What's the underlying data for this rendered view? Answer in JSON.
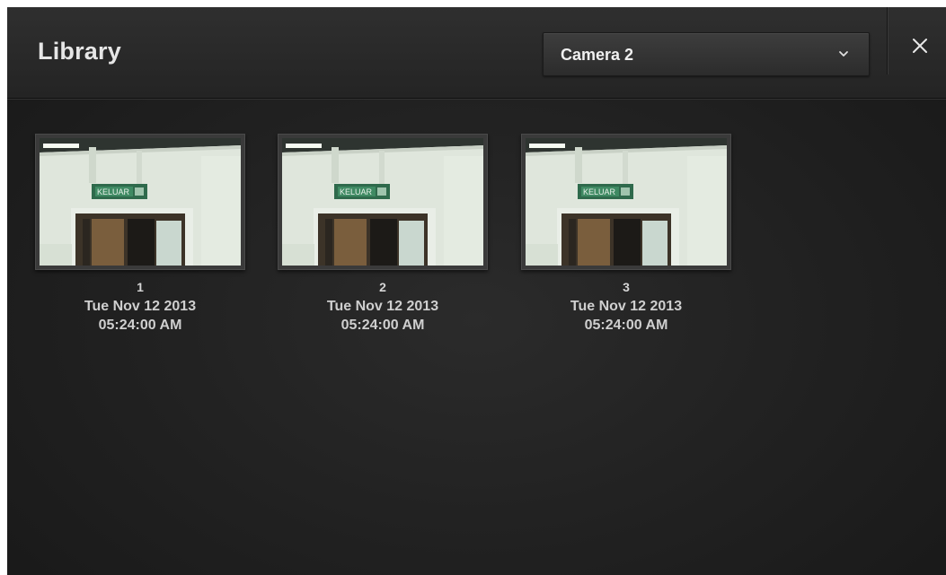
{
  "header": {
    "title": "Library",
    "camera_select": {
      "selected": "Camera 2"
    },
    "close_icon": "close-icon"
  },
  "thumbnails": [
    {
      "index": "1",
      "date": "Tue Nov 12 2013",
      "time": "05:24:00 AM",
      "sign_text": "KELUAR"
    },
    {
      "index": "2",
      "date": "Tue Nov 12 2013",
      "time": "05:24:00 AM",
      "sign_text": "KELUAR"
    },
    {
      "index": "3",
      "date": "Tue Nov 12 2013",
      "time": "05:24:00 AM",
      "sign_text": "KELUAR"
    }
  ],
  "colors": {
    "background": "#222222",
    "header": "#2a2a2a",
    "text": "#e6e6e6",
    "caption": "#cfcfcf"
  }
}
